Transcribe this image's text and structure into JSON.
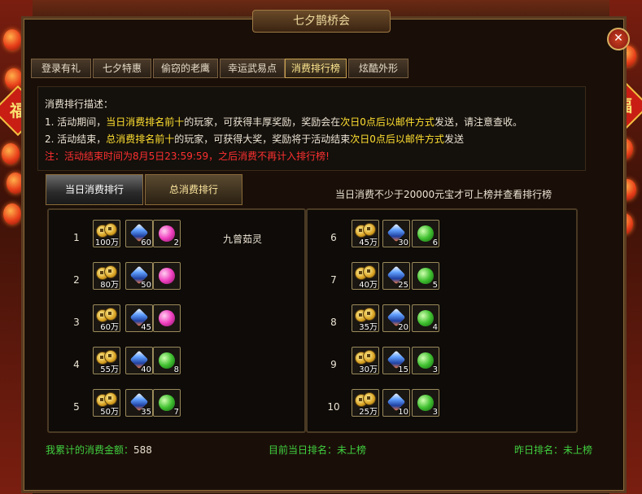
{
  "window": {
    "title": "七夕鹊桥会"
  },
  "banner_char": "福",
  "tabs": [
    "登录有礼",
    "七夕特惠",
    "偷窃的老鹰",
    "幸运武易点",
    "消费排行榜",
    "炫酷外形"
  ],
  "active_tab": "消费排行榜",
  "description": {
    "heading": "消费排行描述：",
    "line1": {
      "a": "1. 活动期间，",
      "b": "当日消费排名前十",
      "c": "的玩家，可获得丰厚奖励，奖励会在",
      "d": "次日0点后以邮件方式",
      "e": "发送，请注意查收。"
    },
    "line2": {
      "a": "2. 活动结束，",
      "b": "总消费排名前十",
      "c": "的玩家，可获得大奖，奖励将于活动结束",
      "d": "次日0点后以邮件方式",
      "e": "发送"
    },
    "warning": "注：活动结束时间为8月5日23:59:59，之后消费不再计入排行榜!"
  },
  "subtabs": {
    "daily": "当日消费排行",
    "total": "总消费排行"
  },
  "requirement_note": "当日消费不少于20000元宝才可上榜并查看排行榜",
  "ranks_left": [
    {
      "rank": "1",
      "coin": "100万",
      "scroll": "60",
      "gem": "2",
      "gem_color": "pink",
      "player": "九曾茹灵"
    },
    {
      "rank": "2",
      "coin": "80万",
      "scroll": "50",
      "gem": "",
      "gem_color": "pink",
      "player": ""
    },
    {
      "rank": "3",
      "coin": "60万",
      "scroll": "45",
      "gem": "",
      "gem_color": "pink",
      "player": ""
    },
    {
      "rank": "4",
      "coin": "55万",
      "scroll": "40",
      "gem": "8",
      "gem_color": "green",
      "player": ""
    },
    {
      "rank": "5",
      "coin": "50万",
      "scroll": "35",
      "gem": "7",
      "gem_color": "green",
      "player": ""
    }
  ],
  "ranks_right": [
    {
      "rank": "6",
      "coin": "45万",
      "scroll": "30",
      "gem": "6",
      "gem_color": "green"
    },
    {
      "rank": "7",
      "coin": "40万",
      "scroll": "25",
      "gem": "5",
      "gem_color": "green"
    },
    {
      "rank": "8",
      "coin": "35万",
      "scroll": "20",
      "gem": "4",
      "gem_color": "green"
    },
    {
      "rank": "9",
      "coin": "30万",
      "scroll": "15",
      "gem": "3",
      "gem_color": "green"
    },
    {
      "rank": "10",
      "coin": "25万",
      "scroll": "10",
      "gem": "3",
      "gem_color": "green"
    }
  ],
  "footer": {
    "total_label": "我累计的消费金额：",
    "total_value": "588",
    "today_label": "目前当日排名：",
    "today_value": "未上榜",
    "yesterday_label": "昨日排名：",
    "yesterday_value": "未上榜"
  },
  "colors": {
    "highlight": "#ffe030",
    "warning": "#ff3030",
    "footer_green": "#40d040"
  }
}
